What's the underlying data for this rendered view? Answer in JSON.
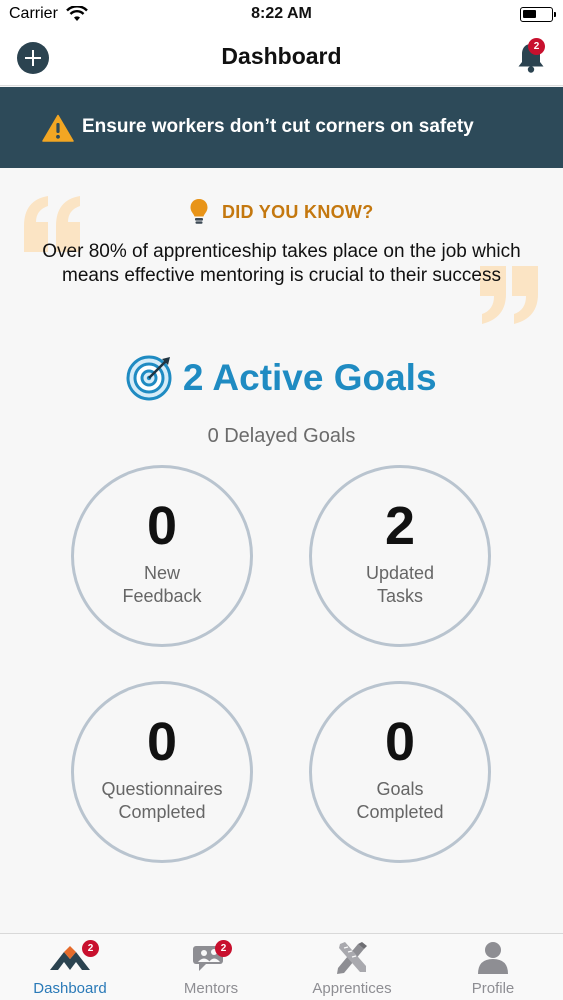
{
  "status_bar": {
    "carrier": "Carrier",
    "time": "8:22 AM"
  },
  "nav": {
    "title": "Dashboard",
    "notification_count": "2"
  },
  "banner": {
    "text": "Ensure workers don’t cut corners on safety"
  },
  "did_you_know": {
    "heading": "DID YOU KNOW?",
    "fact": "Over 80% of apprenticeship takes place on the job which means effective mentoring is crucial to their success"
  },
  "goals": {
    "active": "2 Active Goals",
    "delayed": "0 Delayed Goals"
  },
  "stats": [
    {
      "value": "0",
      "line1": "New",
      "line2": "Feedback"
    },
    {
      "value": "2",
      "line1": "Updated",
      "line2": "Tasks"
    },
    {
      "value": "0",
      "line1": "Questionnaires",
      "line2": "Completed"
    },
    {
      "value": "0",
      "line1": "Goals",
      "line2": "Completed"
    }
  ],
  "tabs": [
    {
      "label": "Dashboard",
      "icon": "mountain-logo-icon",
      "badge": "2"
    },
    {
      "label": "Mentors",
      "icon": "chat-people-icon",
      "badge": "2"
    },
    {
      "label": "Apprentices",
      "icon": "tools-icon"
    },
    {
      "label": "Profile",
      "icon": "person-icon"
    }
  ],
  "colors": {
    "banner": "#2d4a59",
    "accent_blue": "#1f8bc2",
    "dyk_orange": "#c4780f",
    "badge_red": "#c8102e",
    "active_tab": "#2a7ab8"
  }
}
